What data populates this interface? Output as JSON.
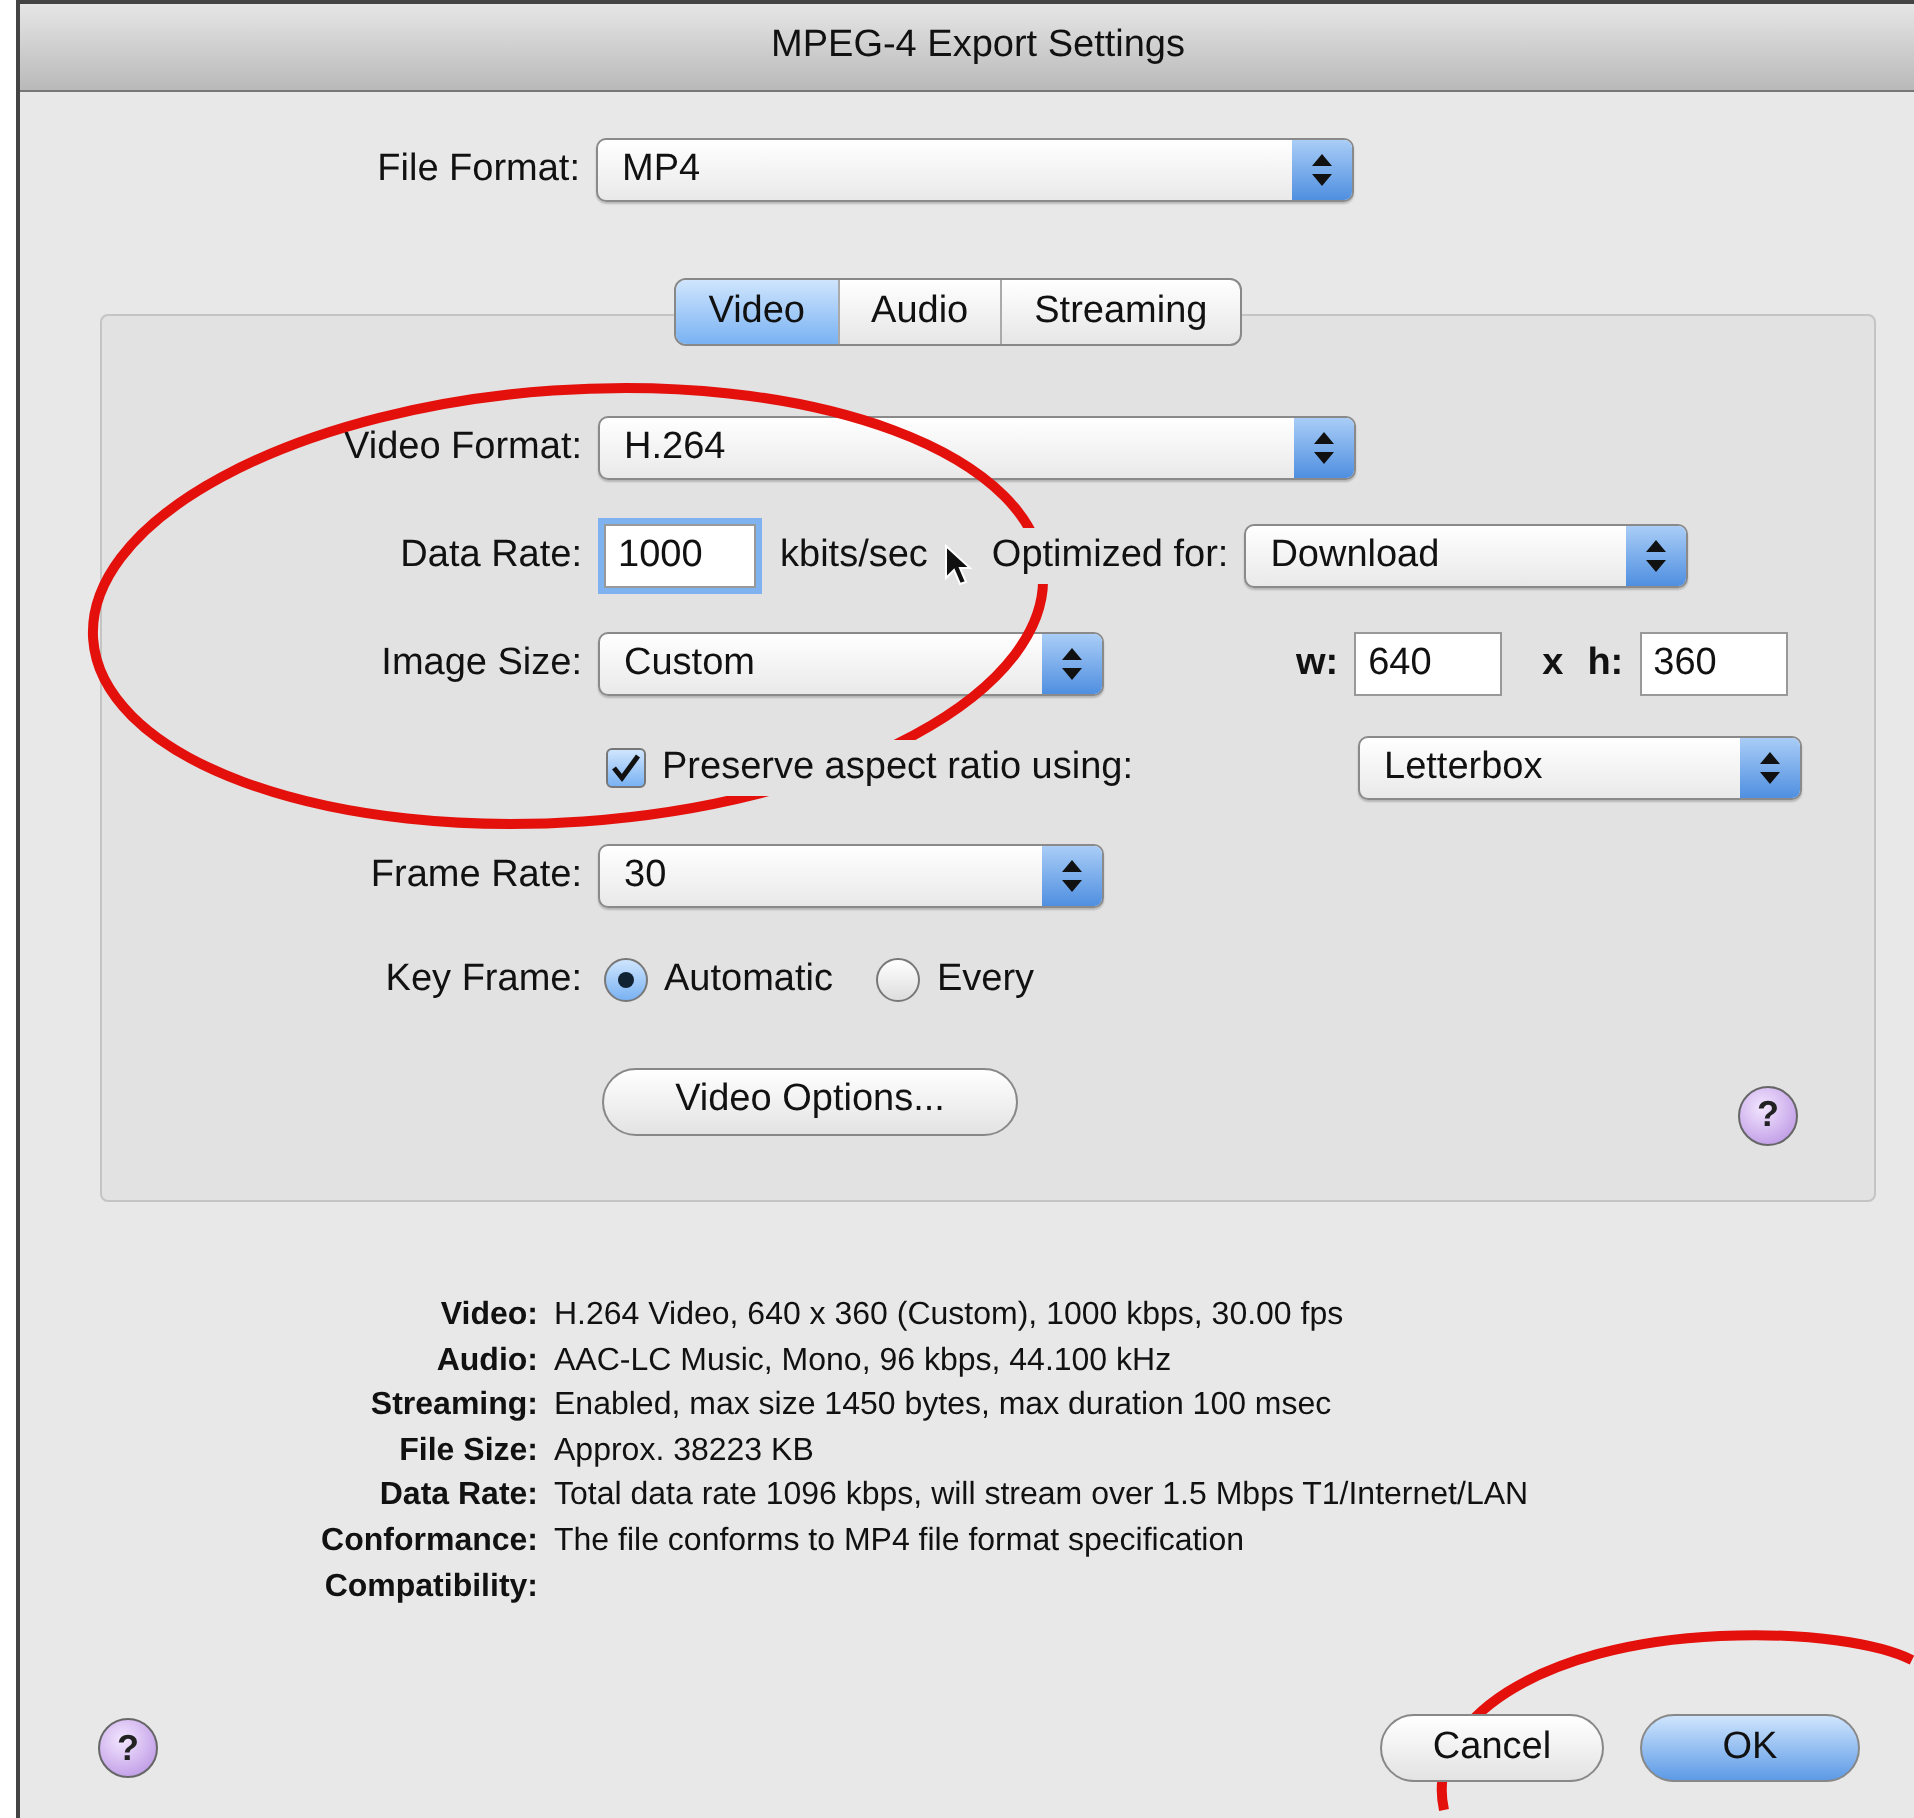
{
  "window": {
    "title": "MPEG-4 Export Settings"
  },
  "file_format": {
    "label": "File Format:",
    "value": "MP4"
  },
  "tabs": [
    {
      "label": "Video",
      "selected": true
    },
    {
      "label": "Audio",
      "selected": false
    },
    {
      "label": "Streaming",
      "selected": false
    }
  ],
  "video_format": {
    "label": "Video Format:",
    "value": "H.264"
  },
  "data_rate": {
    "label": "Data Rate:",
    "value": "1000",
    "unit": "kbits/sec",
    "focused": true
  },
  "optimized_for": {
    "label": "Optimized for:",
    "value": "Download"
  },
  "image_size": {
    "label": "Image Size:",
    "value": "Custom"
  },
  "dimensions": {
    "w_label": "w:",
    "w_value": "640",
    "x_label": "x",
    "h_label": "h:",
    "h_value": "360"
  },
  "preserve_aspect": {
    "label": "Preserve aspect ratio using:",
    "checked": true,
    "value": "Letterbox"
  },
  "frame_rate": {
    "label": "Frame Rate:",
    "value": "30"
  },
  "key_frame": {
    "label": "Key Frame:",
    "options": [
      {
        "label": "Automatic",
        "selected": true
      },
      {
        "label": "Every",
        "selected": false
      }
    ]
  },
  "video_options_button": "Video Options...",
  "panel_help": "?",
  "summary": [
    {
      "label": "Video:",
      "value": "H.264 Video, 640 x 360 (Custom), 1000 kbps, 30.00 fps"
    },
    {
      "label": "Audio:",
      "value": "AAC-LC Music, Mono, 96 kbps, 44.100 kHz"
    },
    {
      "label": "Streaming:",
      "value": "Enabled, max size 1450 bytes, max duration 100 msec"
    },
    {
      "label": "File Size:",
      "value": "Approx. 38223 KB"
    },
    {
      "label": "Data Rate:",
      "value": "Total data rate 1096 kbps, will stream over 1.5 Mbps T1/Internet/LAN"
    },
    {
      "label": "Conformance:",
      "value": "The file conforms to MP4 file format specification"
    },
    {
      "label": "Compatibility:"
    }
  ],
  "footer_help": "?",
  "buttons": [
    {
      "label": "Cancel",
      "default": false
    },
    {
      "label": "OK",
      "default": true
    }
  ]
}
